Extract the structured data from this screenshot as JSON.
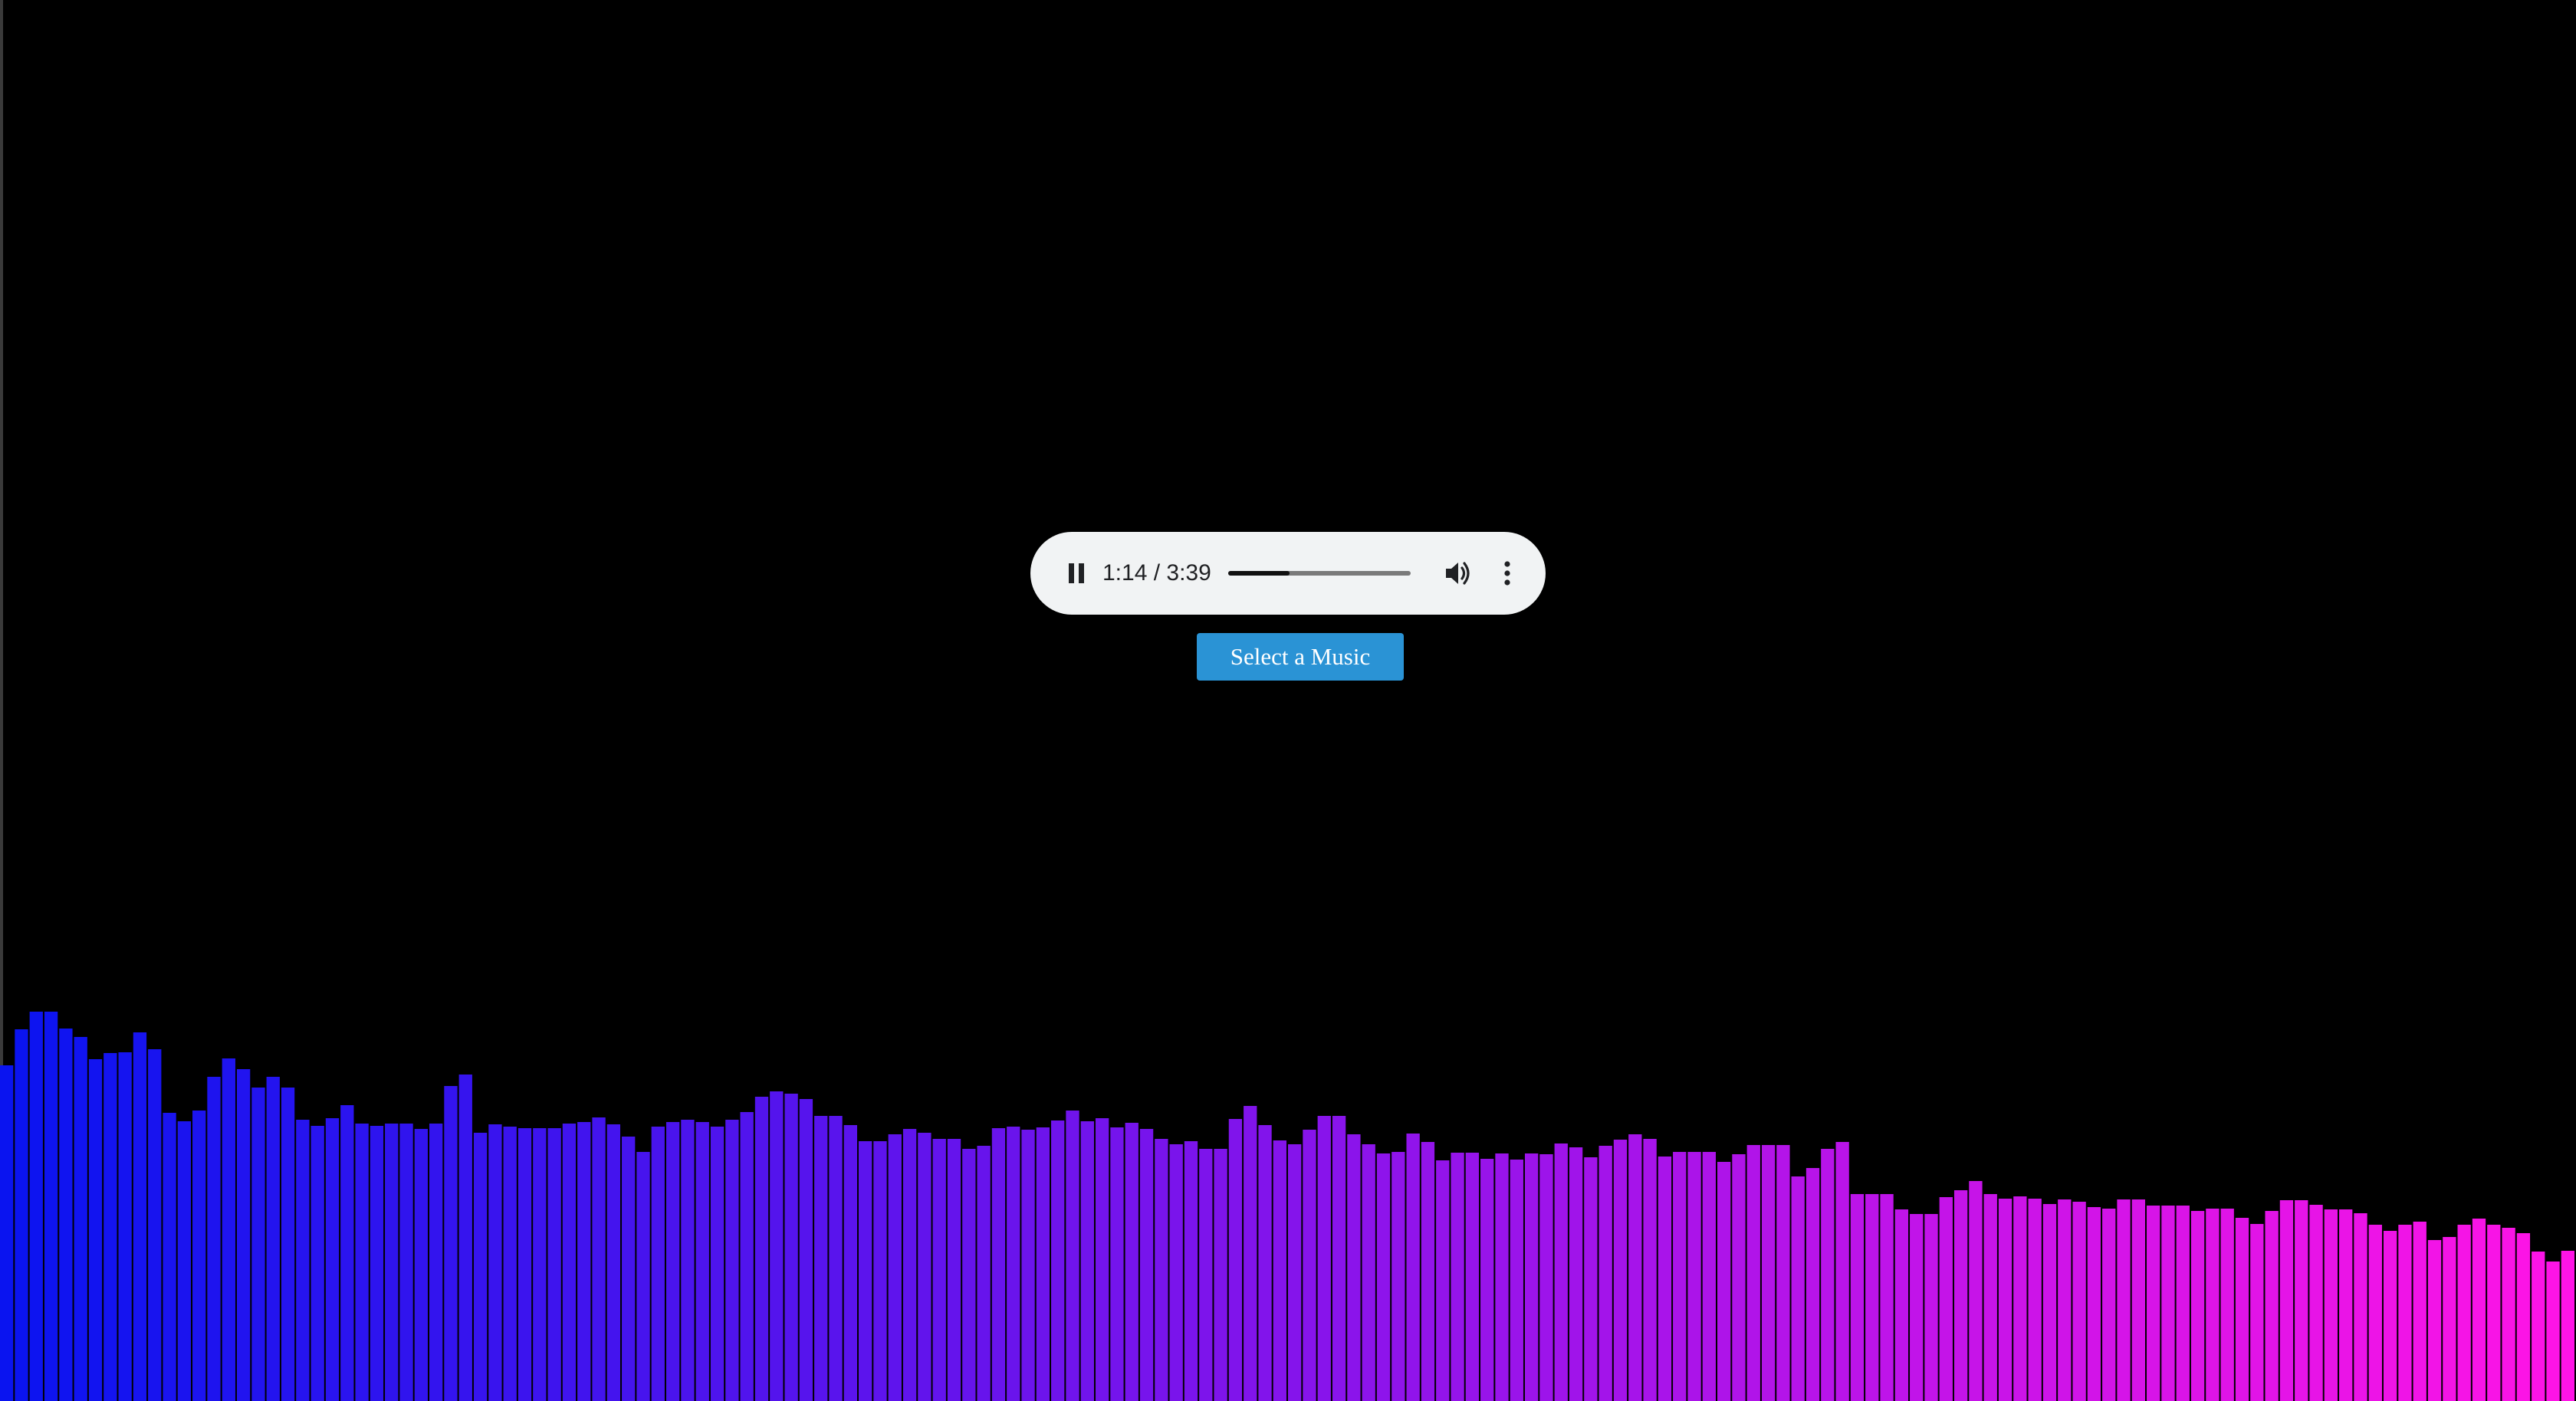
{
  "player": {
    "state": "playing",
    "current_time": "1:14",
    "duration": "3:39",
    "time_text": "1:14 / 3:39",
    "progress_fraction": 0.338,
    "icons": {
      "play_pause": "pause-icon",
      "volume": "volume-icon",
      "more": "more-options-icon"
    }
  },
  "select_button": {
    "label": "Select a Music",
    "color": "#2a93d5"
  },
  "visualizer": {
    "color_start": "#0a14f0",
    "color_end": "#ff14e6",
    "max_level": 548,
    "levels": [
      438,
      485,
      508,
      508,
      486,
      475,
      446,
      454,
      455,
      481,
      459,
      376,
      365,
      379,
      423,
      447,
      433,
      409,
      423,
      409,
      367,
      359,
      369,
      386,
      362,
      359,
      362,
      362,
      355,
      362,
      411,
      426,
      350,
      361,
      358,
      356,
      356,
      356,
      362,
      364,
      370,
      361,
      345,
      325,
      358,
      364,
      367,
      364,
      358,
      367,
      377,
      397,
      404,
      401,
      394,
      372,
      372,
      360,
      339,
      339,
      348,
      355,
      350,
      342,
      342,
      329,
      333,
      356,
      358,
      354,
      357,
      366,
      379,
      365,
      369,
      357,
      363,
      355,
      342,
      335,
      339,
      329,
      329,
      368,
      385,
      360,
      340,
      335,
      354,
      372,
      372,
      348,
      335,
      323,
      325,
      349,
      338,
      314,
      324,
      324,
      316,
      323,
      315,
      323,
      322,
      336,
      331,
      318,
      333,
      341,
      348,
      342,
      319,
      325,
      325,
      325,
      312,
      322,
      334,
      334,
      334,
      293,
      304,
      329,
      338,
      270,
      270,
      270,
      250,
      244,
      244,
      266,
      275,
      287,
      270,
      264,
      267,
      264,
      257,
      263,
      260,
      253,
      251,
      263,
      263,
      255,
      255,
      255,
      248,
      251,
      251,
      239,
      231,
      248,
      262,
      262,
      256,
      250,
      250,
      245,
      230,
      222,
      230,
      234,
      210,
      214,
      230,
      238,
      230,
      226,
      219,
      195,
      182,
      196
    ]
  }
}
